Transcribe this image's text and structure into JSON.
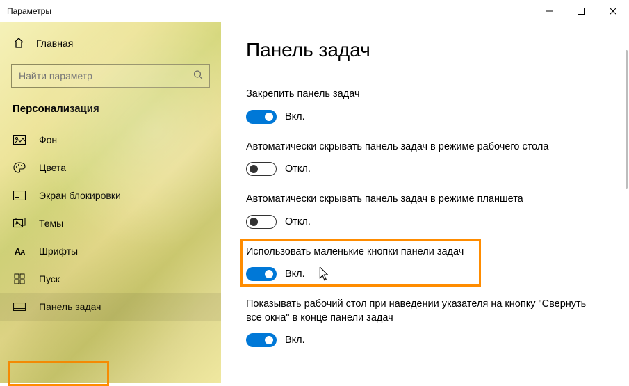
{
  "window": {
    "title": "Параметры"
  },
  "sidebar": {
    "home_label": "Главная",
    "search_placeholder": "Найти параметр",
    "category": "Персонализация",
    "items": [
      {
        "label": "Фон"
      },
      {
        "label": "Цвета"
      },
      {
        "label": "Экран блокировки"
      },
      {
        "label": "Темы"
      },
      {
        "label": "Шрифты"
      },
      {
        "label": "Пуск"
      },
      {
        "label": "Панель задач"
      }
    ]
  },
  "page": {
    "title": "Панель задач",
    "state_on": "Вкл.",
    "state_off": "Откл.",
    "settings": [
      {
        "label": "Закрепить панель задач",
        "on": true
      },
      {
        "label": "Автоматически скрывать панель задач в режиме рабочего стола",
        "on": false
      },
      {
        "label": "Автоматически скрывать панель задач в режиме планшета",
        "on": false
      },
      {
        "label": "Использовать маленькие кнопки панели задач",
        "on": true
      },
      {
        "label": "Показывать рабочий стол при наведении указателя на кнопку \"Свернуть все окна\" в конце панели задач",
        "on": true
      }
    ],
    "highlight_index": 3
  },
  "colors": {
    "accent": "#0078d7",
    "highlight": "#ff8c00"
  }
}
